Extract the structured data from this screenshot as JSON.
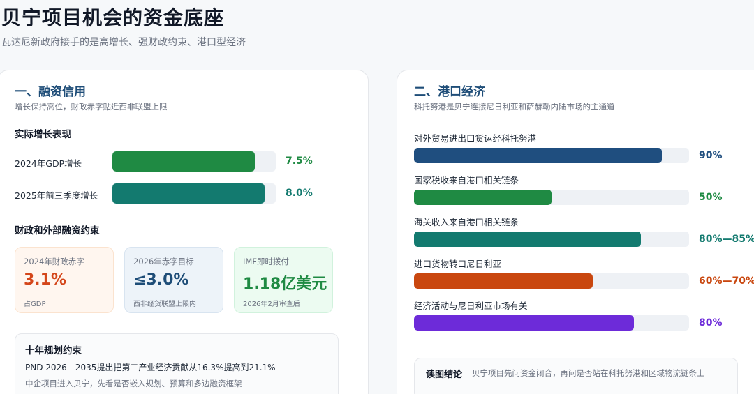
{
  "header": {
    "title": "贝宁项目机会的资金底座",
    "subtitle": "瓦达尼新政府接手的是高增长、强财政约束、港口型经济"
  },
  "left": {
    "title": "一、融资信用",
    "subtitle": "增长保持高位，财政赤字贴近西非联盟上限",
    "growth_title": "实际增长表现",
    "growth_rows": [
      {
        "label": "2024年GDP增长",
        "value": 7.5,
        "value_text": "7.5%",
        "color": "#1f8a43"
      },
      {
        "label": "2025年前三季度增长",
        "value": 8.0,
        "value_text": "8.0%",
        "color": "#137a6f"
      }
    ],
    "fiscal_title": "财政和外部融资约束",
    "stats": [
      {
        "label": "2024年财政赤字",
        "value": "3.1%",
        "note": "占GDP",
        "color": "#d4461a",
        "bg": "#fff6ef",
        "border": "#fbe3cf"
      },
      {
        "label": "2026年赤字目标",
        "value": "≤3.0%",
        "note": "西非经货联盟上限内",
        "color": "#1e4d78",
        "bg": "#edf3f9",
        "border": "#d8e4f0"
      },
      {
        "label": "IMF即时拨付",
        "value": "1.18亿美元",
        "note": "2026年2月审查后",
        "color": "#1f8a43",
        "bg": "#ecfbf1",
        "border": "#d1f2dd"
      }
    ],
    "plan": {
      "title": "十年规划约束",
      "line1": "PND 2026—2035提出把第二产业经济贡献从16.3%提高到21.1%",
      "line2": "中企项目进入贝宁，先看是否嵌入规划、预算和多边融资框架"
    }
  },
  "right": {
    "title": "二、港口经济",
    "subtitle": "科托努港是贝宁连接尼日利亚和萨赫勒内陆市场的主通道",
    "bars": [
      {
        "label": "对外贸易进出口货运经科托努港",
        "fill": 0.9,
        "value_text": "90%",
        "color": "#1f4e7f"
      },
      {
        "label": "国家税收来自港口相关链条",
        "fill": 0.5,
        "value_text": "50%",
        "color": "#1f8a43"
      },
      {
        "label": "海关收入来自港口相关链条",
        "fill": 0.825,
        "value_text": "80%—85%",
        "color": "#137a6f"
      },
      {
        "label": "进口货物转口尼日利亚",
        "fill": 0.65,
        "value_text": "60%—70%",
        "color": "#c9470f"
      },
      {
        "label": "经济活动与尼日利亚市场有关",
        "fill": 0.8,
        "value_text": "80%",
        "color": "#6d2bd9"
      }
    ],
    "conclusion": {
      "label": "读图结论",
      "text": "贝宁项目先问资金闭合，再问是否站在科托努港和区域物流链条上"
    }
  }
}
